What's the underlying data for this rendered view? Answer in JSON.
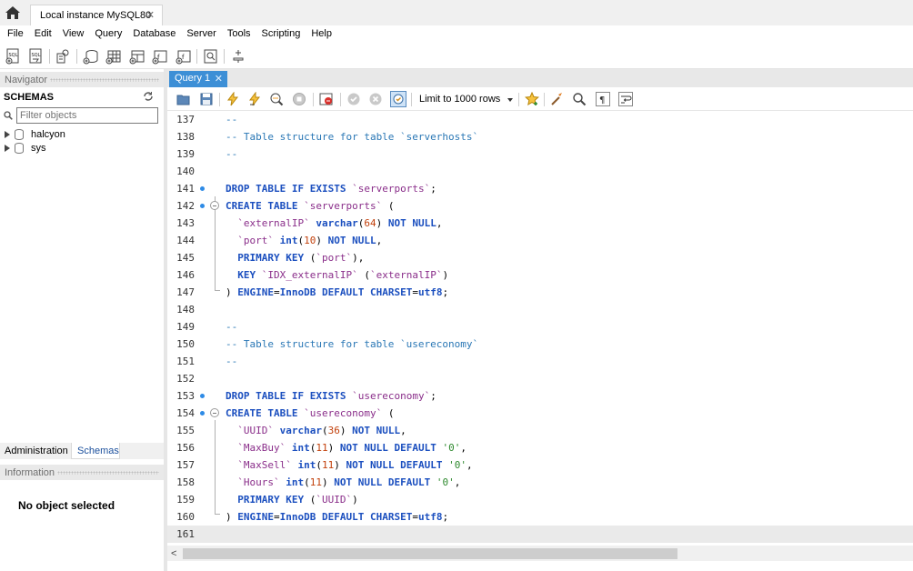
{
  "window": {
    "connection_tab": "Local instance MySQL80",
    "close_glyph": "✕"
  },
  "menu": [
    "File",
    "Edit",
    "View",
    "Query",
    "Database",
    "Server",
    "Tools",
    "Scripting",
    "Help"
  ],
  "navigator": {
    "header": "Navigator",
    "schemas_label": "SCHEMAS",
    "filter_placeholder": "Filter objects",
    "schemas": [
      "halcyon",
      "sys"
    ],
    "tabs": [
      "Administration",
      "Schemas"
    ],
    "info_header": "Information",
    "info_text": "No object selected"
  },
  "query_tab": {
    "label": "Query 1",
    "close_glyph": "✕"
  },
  "query_toolbar": {
    "limit_label": "Limit to 1000 rows"
  },
  "editor": {
    "current_line": 161,
    "lines": [
      {
        "num": "137",
        "text": "--"
      },
      {
        "num": "138",
        "text": "-- Table structure for table `serverhosts`"
      },
      {
        "num": "139",
        "text": "--"
      },
      {
        "num": "140",
        "text": ""
      },
      {
        "num": "141",
        "text": "DROP TABLE IF EXISTS `serverports`;"
      },
      {
        "num": "142",
        "text": "CREATE TABLE `serverports` ("
      },
      {
        "num": "143",
        "text": "  `externalIP` varchar(64) NOT NULL,"
      },
      {
        "num": "144",
        "text": "  `port` int(10) NOT NULL,"
      },
      {
        "num": "145",
        "text": "  PRIMARY KEY (`port`),"
      },
      {
        "num": "146",
        "text": "  KEY `IDX_externalIP` (`externalIP`)"
      },
      {
        "num": "147",
        "text": ") ENGINE=InnoDB DEFAULT CHARSET=utf8;"
      },
      {
        "num": "148",
        "text": ""
      },
      {
        "num": "149",
        "text": "--"
      },
      {
        "num": "150",
        "text": "-- Table structure for table `usereconomy`"
      },
      {
        "num": "151",
        "text": "--"
      },
      {
        "num": "152",
        "text": ""
      },
      {
        "num": "153",
        "text": "DROP TABLE IF EXISTS `usereconomy`;"
      },
      {
        "num": "154",
        "text": "CREATE TABLE `usereconomy` ("
      },
      {
        "num": "155",
        "text": "  `UUID` varchar(36) NOT NULL,"
      },
      {
        "num": "156",
        "text": "  `MaxBuy` int(11) NOT NULL DEFAULT '0',"
      },
      {
        "num": "157",
        "text": "  `MaxSell` int(11) NOT NULL DEFAULT '0',"
      },
      {
        "num": "158",
        "text": "  `Hours` int(11) NOT NULL DEFAULT '0',"
      },
      {
        "num": "159",
        "text": "  PRIMARY KEY (`UUID`)"
      },
      {
        "num": "160",
        "text": ") ENGINE=InnoDB DEFAULT CHARSET=utf8;"
      },
      {
        "num": "161",
        "text": ""
      }
    ]
  },
  "syntax_colors": {
    "keyword": "#1b4fbf",
    "comment": "#2a77b5",
    "identifier": "#8a2e8a",
    "number": "#c2410c",
    "string": "#2f8a2f",
    "marker": "#2e8be6"
  },
  "scrollbar": {
    "left_arrow": "<"
  }
}
